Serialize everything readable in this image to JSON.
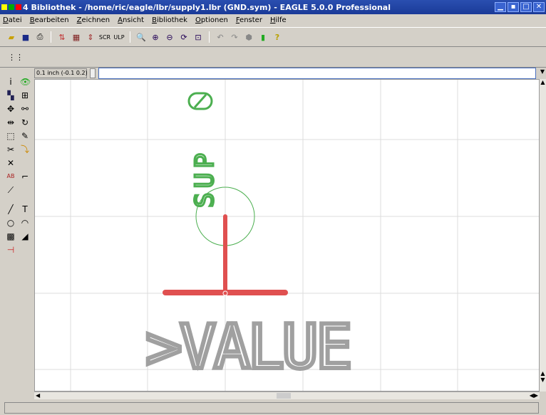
{
  "window": {
    "title": "4 Bibliothek - /home/ric/eagle/lbr/supply1.lbr (GND.sym) - EAGLE 5.0.0 Professional"
  },
  "menu": [
    "Datei",
    "Bearbeiten",
    "Zeichnen",
    "Ansicht",
    "Bibliothek",
    "Optionen",
    "Fenster",
    "Hilfe"
  ],
  "coordinates": {
    "readout": "0.1 inch (-0.1 0.2)"
  },
  "command_line": {
    "value": ""
  },
  "canvas": {
    "sup_text": "SUP",
    "value_text": ">VALUE"
  },
  "colors": {
    "title_bar": "#1a3a98",
    "symbol_text": "#4caf50",
    "pin": "#e05050",
    "value_text": "#a0a0a0",
    "grid": "#dcdcdc"
  }
}
